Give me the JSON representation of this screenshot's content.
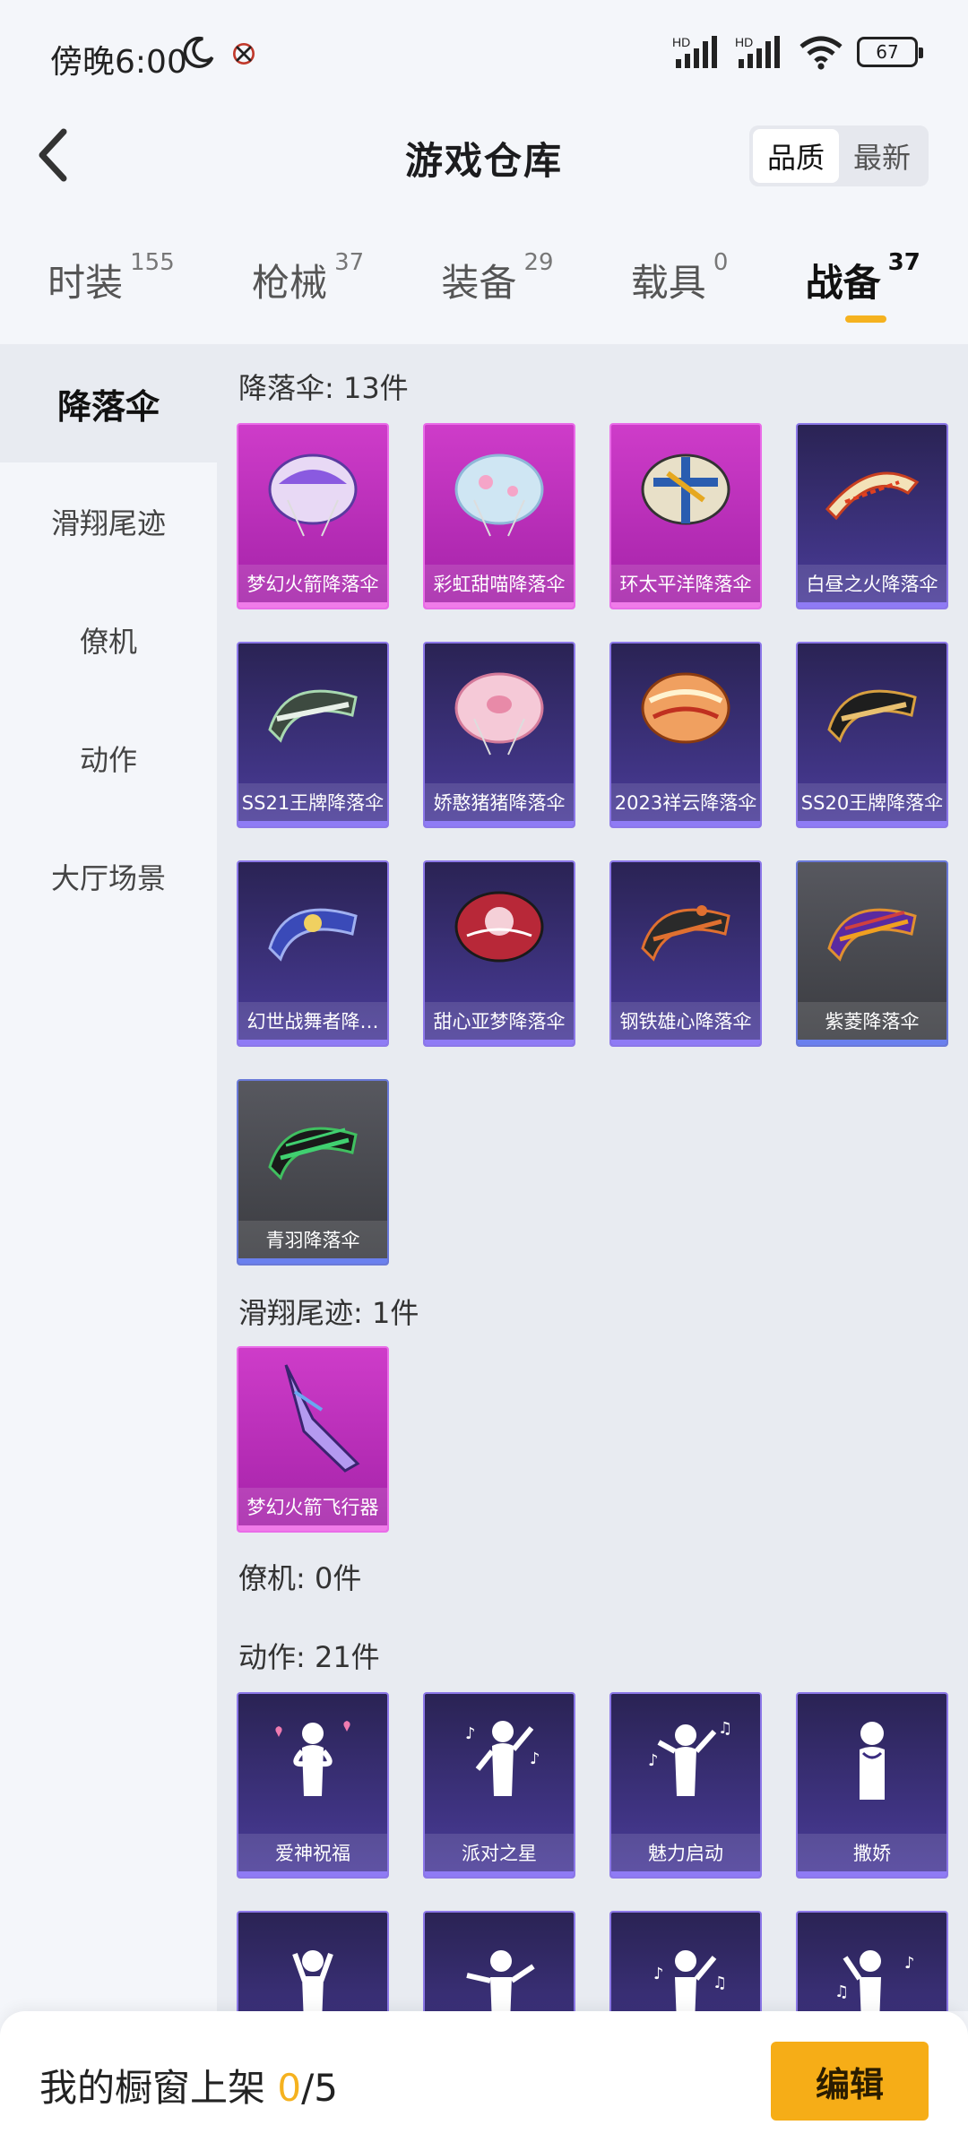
{
  "status_bar": {
    "time": "傍晚6:00",
    "battery": "67"
  },
  "header": {
    "title": "游戏仓库",
    "sort_quality": "品质",
    "sort_newest": "最新"
  },
  "tabs": [
    {
      "label": "时装",
      "count": "155"
    },
    {
      "label": "枪械",
      "count": "37"
    },
    {
      "label": "装备",
      "count": "29"
    },
    {
      "label": "载具",
      "count": "0"
    },
    {
      "label": "战备",
      "count": "37"
    }
  ],
  "sidebar": [
    "降落伞",
    "滑翔尾迹",
    "僚机",
    "动作",
    "大厅场景"
  ],
  "sections": {
    "parachute": {
      "title": "降落伞: 13件",
      "items": [
        "梦幻火箭降落伞",
        "彩虹甜喵降落伞",
        "环太平洋降落伞",
        "白昼之火降落伞",
        "SS21王牌降落伞",
        "娇憨猪猪降落伞",
        "2023祥云降落伞",
        "SS20王牌降落伞",
        "幻世战舞者降…",
        "甜心亚梦降落伞",
        "钢铁雄心降落伞",
        "紫菱降落伞",
        "青羽降落伞"
      ]
    },
    "glide_trail": {
      "title": "滑翔尾迹: 1件",
      "items": [
        "梦幻火箭飞行器"
      ]
    },
    "wingman": {
      "title": "僚机: 0件"
    },
    "emote": {
      "title": "动作: 21件",
      "items": [
        "爱神祝福",
        "派对之星",
        "魅力启动",
        "撒娇"
      ]
    }
  },
  "bottom": {
    "showcase_label": "我的橱窗上架 ",
    "showcase_used": "0",
    "showcase_total": "/5",
    "edit_label": "编辑"
  }
}
